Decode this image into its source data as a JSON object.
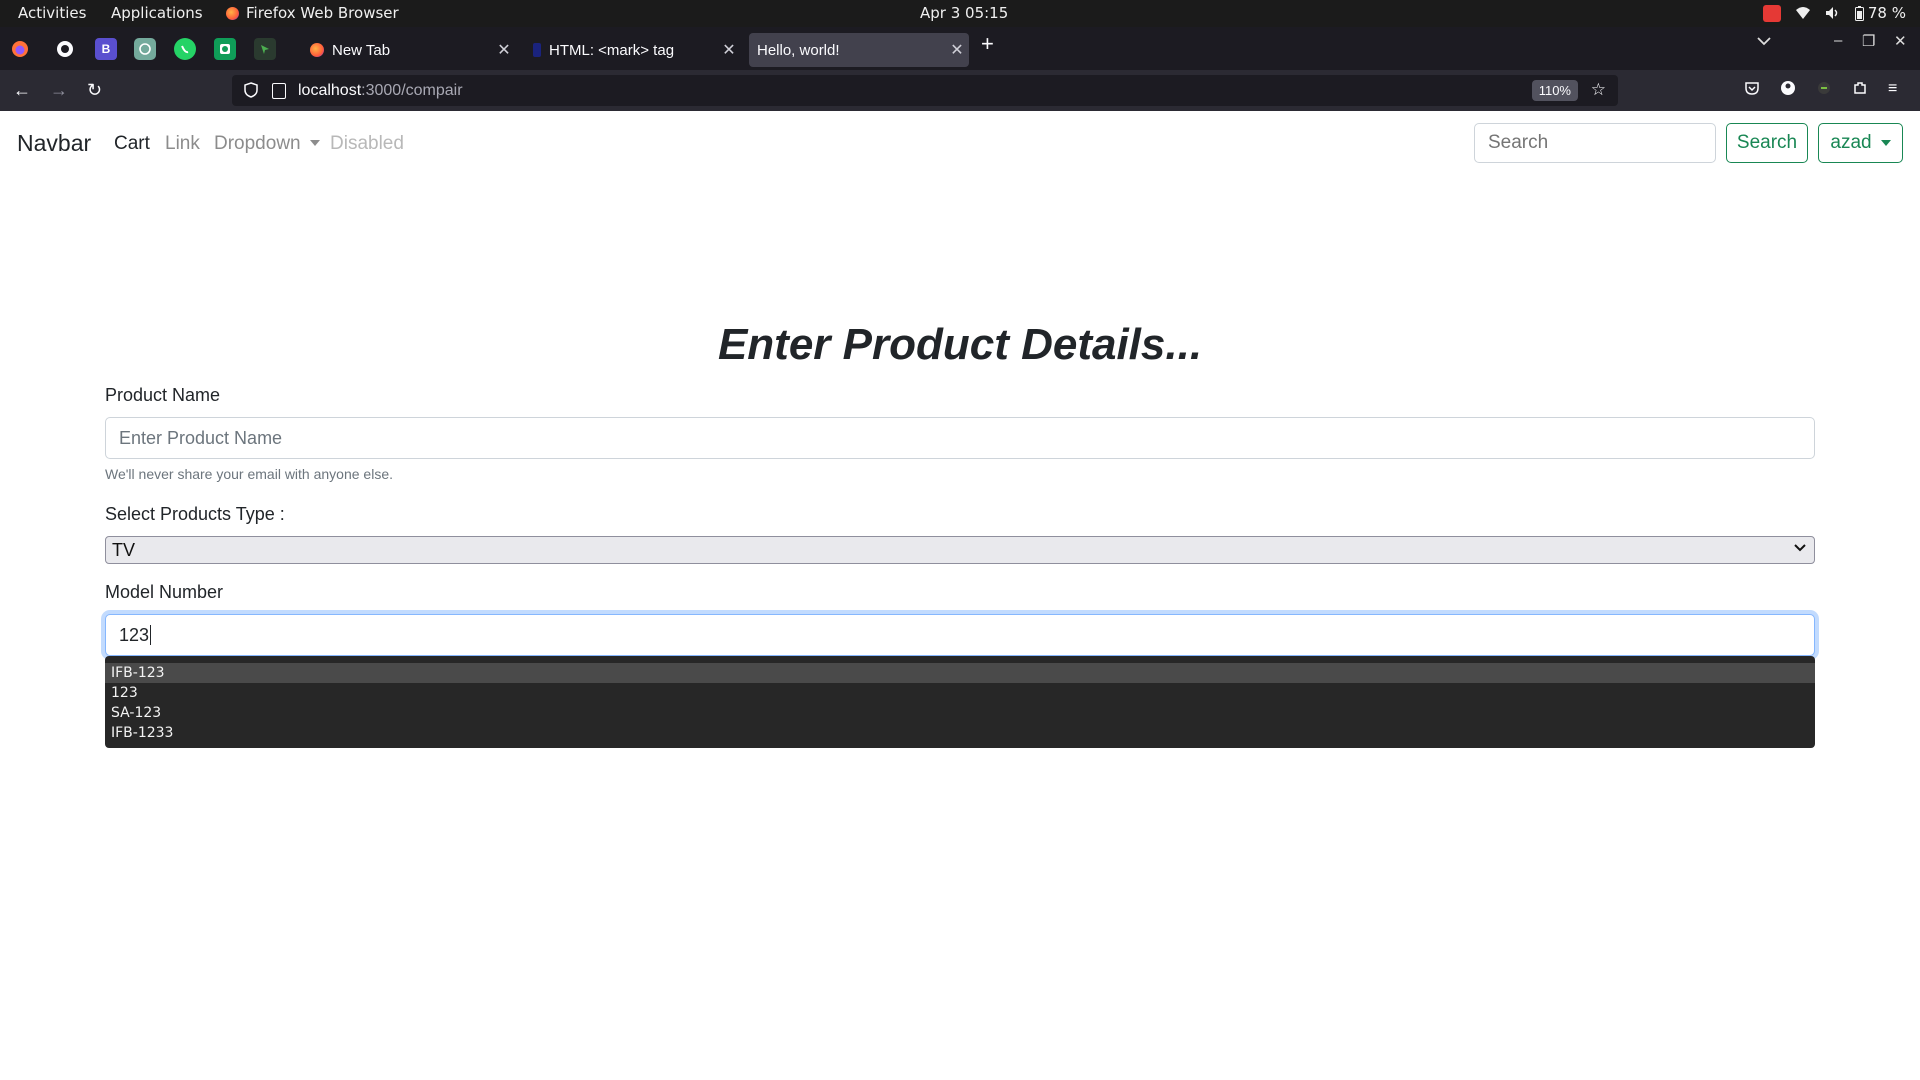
{
  "system_bar": {
    "activities": "Activities",
    "applications": "Applications",
    "app_name": "Firefox Web Browser",
    "clock": "Apr 3  05:15",
    "battery": "78 %"
  },
  "browser": {
    "tabs": [
      {
        "title": "New Tab",
        "active": false
      },
      {
        "title": "HTML: <mark> tag",
        "active": false
      },
      {
        "title": "Hello, world!",
        "active": true
      }
    ],
    "url_host": "localhost",
    "url_path": ":3000/compair",
    "zoom": "110%"
  },
  "site_nav": {
    "brand": "Navbar",
    "links": [
      "Cart",
      "Link",
      "Dropdown",
      "Disabled"
    ],
    "search_placeholder": "Search",
    "search_button": "Search",
    "user_button": "azad"
  },
  "form": {
    "heading": "Enter Product Details...",
    "product_name_label": "Product Name",
    "product_name_placeholder": "Enter Product Name",
    "help_text": "We'll never share your email with anyone else.",
    "type_label": "Select Products Type :",
    "type_selected": "TV",
    "model_label": "Model Number",
    "model_value": "123",
    "suggestions": [
      "IFB-123",
      "123",
      "SA-123",
      "IFB-1233"
    ]
  },
  "colors": {
    "success": "#198754",
    "focus": "#86b7fe",
    "browser_dark": "#1c1b22"
  }
}
